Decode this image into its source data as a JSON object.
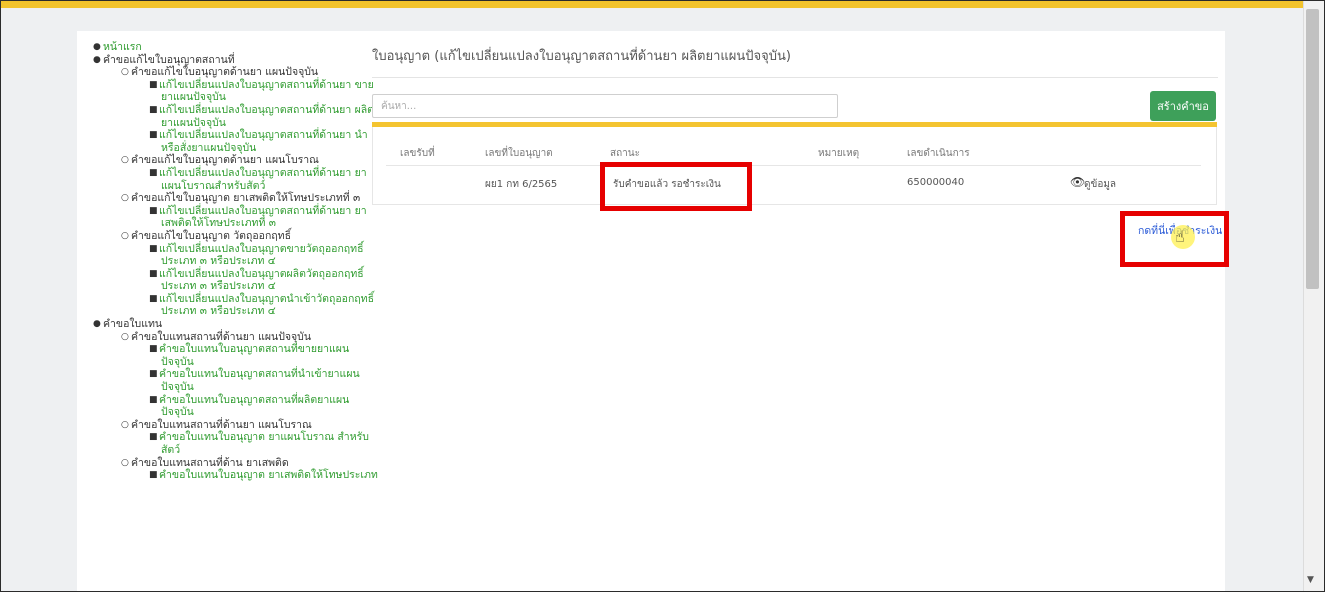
{
  "page": {
    "title": "ใบอนุญาต (แก้ไขเปลี่ยนแปลงใบอนุญาตสถานที่ด้านยา ผลิตยาแผนปัจจุบัน)"
  },
  "search": {
    "placeholder": "ค้นหา..."
  },
  "buttons": {
    "create": "สร้างคำขอ"
  },
  "table": {
    "headers": [
      "เลขรับที่",
      "เลขที่ใบอนุญาต",
      "สถานะ",
      "หมายเหตุ",
      "เลขดำเนินการ"
    ],
    "rows": [
      {
        "receive_no": "",
        "license_no": "ผย1 กท 6/2565",
        "status": "รับคำขอแล้ว รอชำระเงิน",
        "note": "",
        "process_no": "650000040",
        "view_label": "ดูข้อมูล"
      }
    ]
  },
  "pay_link": "กดที่นี่เพื่อชำระเงิน",
  "sidebar": [
    {
      "level": 1,
      "text": "หน้าแรก",
      "green": true
    },
    {
      "level": 1,
      "text": "คำขอแก้ไขใบอนุญาตสถานที่",
      "green": false
    },
    {
      "level": 2,
      "text": "คำขอแก้ไขใบอนุญาตด้านยา แผนปัจจุบัน",
      "green": false
    },
    {
      "level": 3,
      "text": "แก้ไขเปลี่ยนแปลงใบอนุญาตสถานที่ด้านยา ขาย",
      "green": true
    },
    {
      "level": 4,
      "text": "ยาแผนปัจจุบัน",
      "green": true
    },
    {
      "level": 3,
      "text": "แก้ไขเปลี่ยนแปลงใบอนุญาตสถานที่ด้านยา ผลิต",
      "green": true
    },
    {
      "level": 4,
      "text": "ยาแผนปัจจุบัน",
      "green": true
    },
    {
      "level": 3,
      "text": "แก้ไขเปลี่ยนแปลงใบอนุญาตสถานที่ด้านยา นำ",
      "green": true
    },
    {
      "level": 4,
      "text": "หรือสั่งยาแผนปัจจุบัน",
      "green": true
    },
    {
      "level": 2,
      "text": "คำขอแก้ไขใบอนุญาตด้านยา แผนโบราณ",
      "green": false
    },
    {
      "level": 3,
      "text": "แก้ไขเปลี่ยนแปลงใบอนุญาตสถานที่ด้านยา ยา",
      "green": true
    },
    {
      "level": 4,
      "text": "แผนโบราณสำหรับสัตว์",
      "green": true
    },
    {
      "level": 2,
      "text": "คำขอแก้ไขใบอนุญาต ยาเสพติดให้โทษประเภทที่ ๓",
      "green": false
    },
    {
      "level": 3,
      "text": "แก้ไขเปลี่ยนแปลงใบอนุญาตสถานที่ด้านยา ยา",
      "green": true
    },
    {
      "level": 4,
      "text": "เสพติดให้โทษประเภทที่ ๓",
      "green": true
    },
    {
      "level": 2,
      "text": "คำขอแก้ไขใบอนุญาต วัตถุออกฤทธิ์",
      "green": false
    },
    {
      "level": 3,
      "text": "แก้ไขเปลี่ยนแปลงใบอนุญาตขายวัตถุออกฤทธิ์",
      "green": true
    },
    {
      "level": 4,
      "text": "ประเภท ๓ หรือประเภท ๔",
      "green": true
    },
    {
      "level": 3,
      "text": "แก้ไขเปลี่ยนแปลงใบอนุญาตผลิตวัตถุออกฤทธิ์",
      "green": true
    },
    {
      "level": 4,
      "text": "ประเภท ๓ หรือประเภท ๔",
      "green": true
    },
    {
      "level": 3,
      "text": "แก้ไขเปลี่ยนแปลงใบอนุญาตนำเข้าวัตถุออกฤทธิ์",
      "green": true
    },
    {
      "level": 4,
      "text": "ประเภท ๓ หรือประเภท ๔",
      "green": true
    },
    {
      "level": 1,
      "text": "คำขอใบแทน",
      "green": false
    },
    {
      "level": 2,
      "text": "คำขอใบแทนสถานที่ด้านยา แผนปัจจุบัน",
      "green": false
    },
    {
      "level": 3,
      "text": "คำขอใบแทนใบอนุญาตสถานที่ขายยาแผน",
      "green": true
    },
    {
      "level": 4,
      "text": "ปัจจุบัน",
      "green": true
    },
    {
      "level": 3,
      "text": "คำขอใบแทนใบอนุญาตสถานที่นำเข้ายาแผน",
      "green": true
    },
    {
      "level": 4,
      "text": "ปัจจุบัน",
      "green": true
    },
    {
      "level": 3,
      "text": "คำขอใบแทนใบอนุญาตสถานที่ผลิตยาแผน",
      "green": true
    },
    {
      "level": 4,
      "text": "ปัจจุบัน",
      "green": true
    },
    {
      "level": 2,
      "text": "คำขอใบแทนสถานที่ด้านยา แผนโบราณ",
      "green": false
    },
    {
      "level": 3,
      "text": "คำขอใบแทนใบอนุญาต ยาแผนโบราณ สำหรับ",
      "green": true
    },
    {
      "level": 4,
      "text": "สัตว์",
      "green": true
    },
    {
      "level": 2,
      "text": "คำขอใบแทนสถานที่ด้าน ยาเสพติด",
      "green": false
    },
    {
      "level": 3,
      "text": "คำขอใบแทนใบอนุญาต ยาเสพติดให้โทษประเภท",
      "green": true
    }
  ],
  "bullets": {
    "level1": "●",
    "level2": "○",
    "level3": "■"
  },
  "icons": {
    "view": "eye-icon",
    "cursor": "hand-pointer-icon"
  }
}
